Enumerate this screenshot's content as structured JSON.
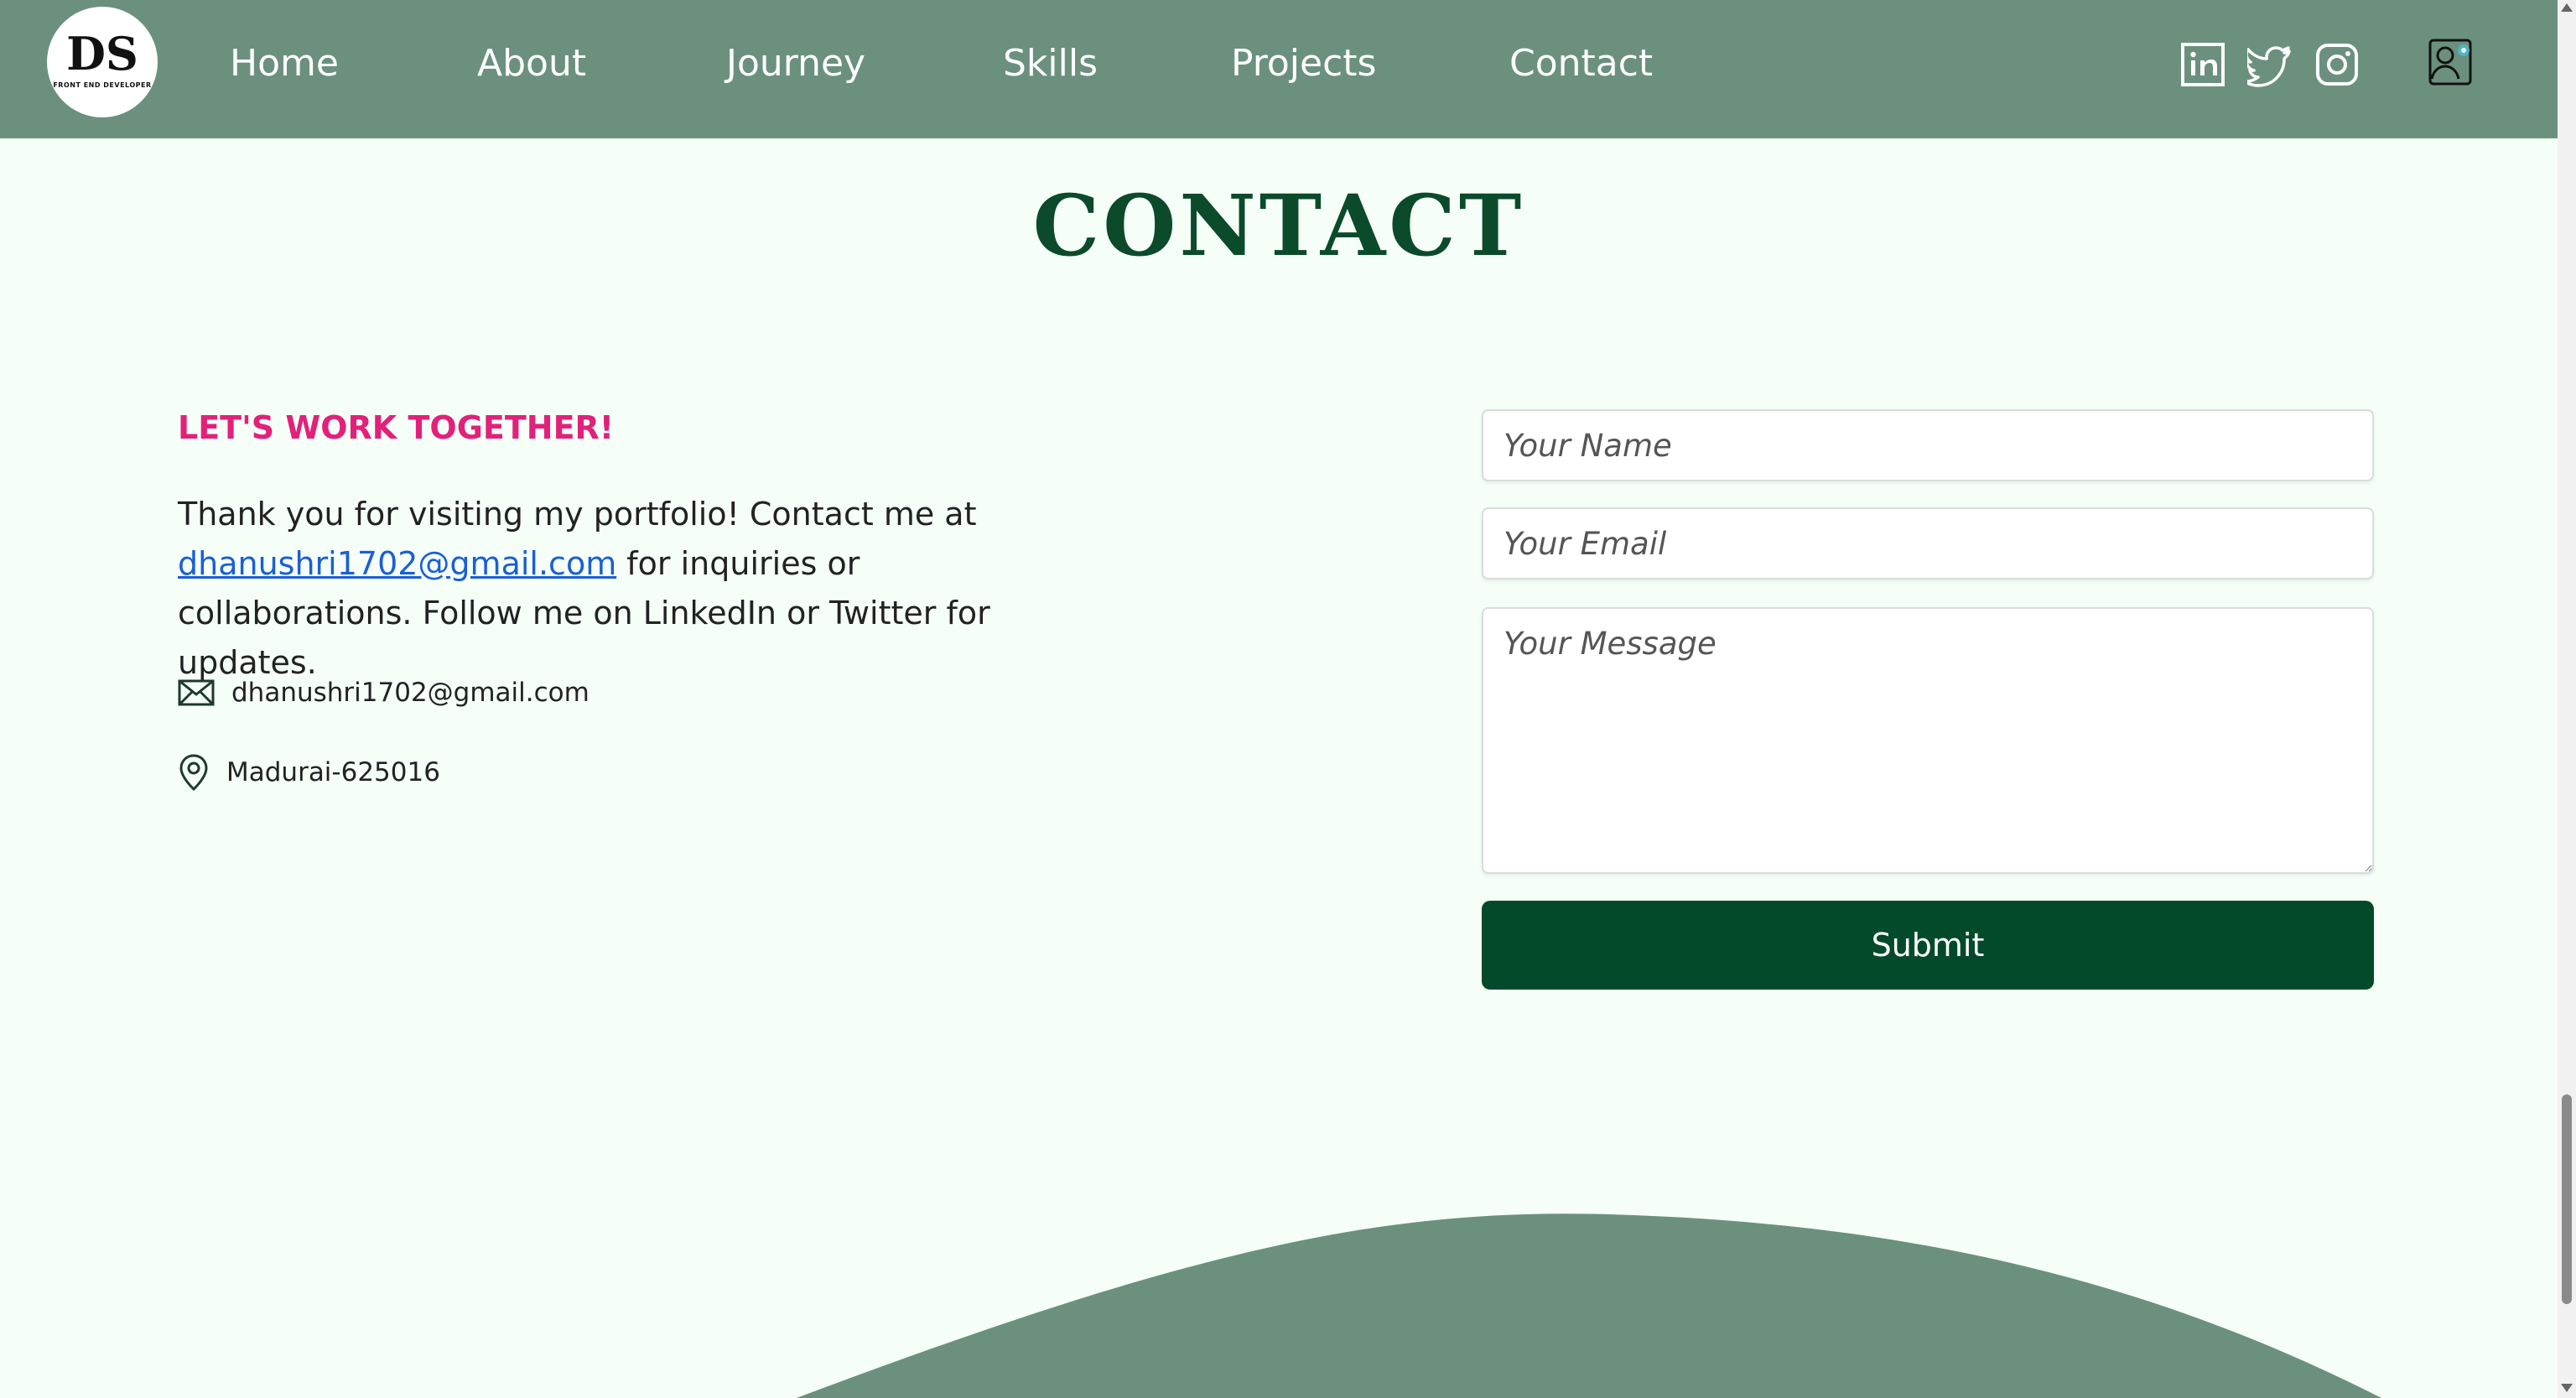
{
  "nav": {
    "logo": {
      "mark": "DS",
      "subtitle": "FRONT END DEVELOPER"
    },
    "links": [
      "Home",
      "About",
      "Journey",
      "Skills",
      "Projects",
      "Contact"
    ],
    "social_icons": [
      "linkedin-icon",
      "twitter-icon",
      "instagram-icon"
    ],
    "profile_icon": "profile-settings-icon"
  },
  "section": {
    "title": "CONTACT",
    "tagline": "LET'S WORK TOGETHER!",
    "intro_before": "Thank you for visiting my portfolio! Contact me at ",
    "intro_email": "dhanushri1702@gmail.com",
    "intro_after": " for inquiries or collaborations. Follow me on LinkedIn or Twitter for updates.",
    "email": "dhanushri1702@gmail.com",
    "location": "Madurai-625016"
  },
  "form": {
    "name_placeholder": "Your Name",
    "email_placeholder": "Your Email",
    "message_placeholder": "Your Message",
    "submit_label": "Submit"
  },
  "colors": {
    "nav_bg": "#6b917e",
    "page_bg": "#f5fff8",
    "title": "#0b4a2b",
    "tagline": "#e2217a",
    "link": "#1a5fd6",
    "button": "#034a2a"
  }
}
